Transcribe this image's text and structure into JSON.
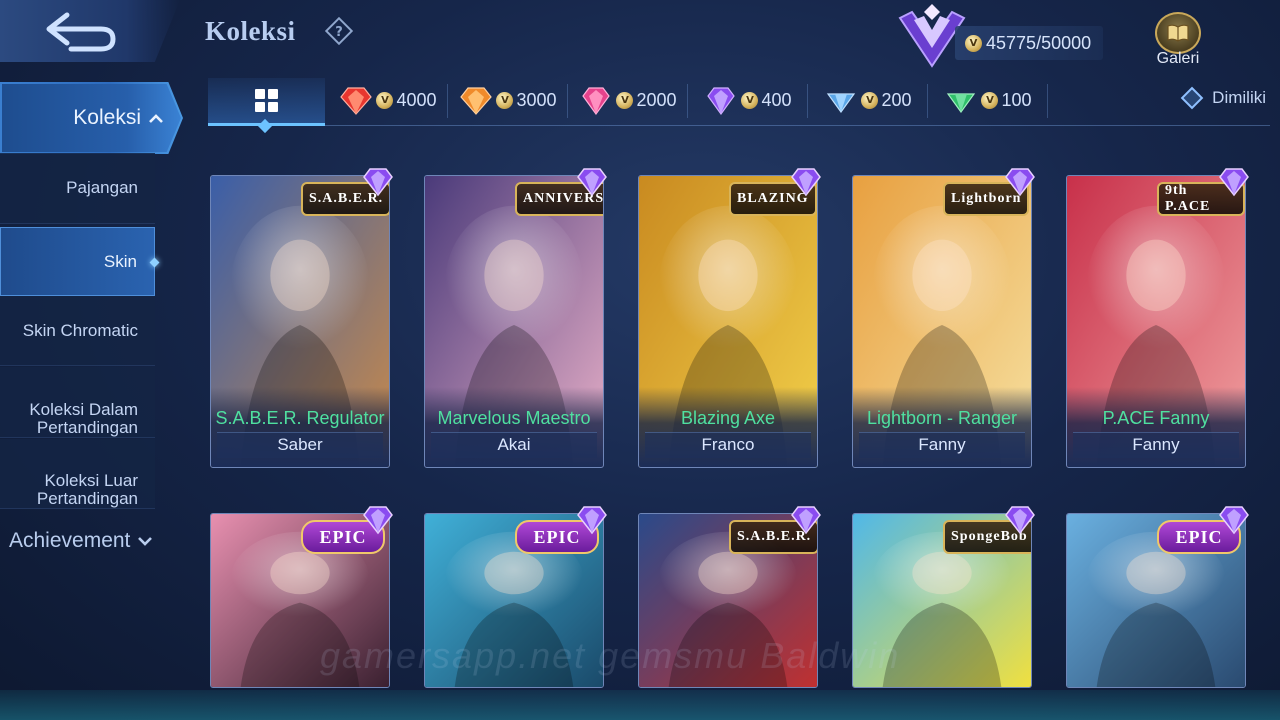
{
  "header": {
    "title": "Koleksi",
    "points_current": "45775",
    "points_max": "/50000",
    "galeri_label": "Galeri",
    "coin_symbol": "V"
  },
  "sidebar": {
    "main_label": "Koleksi",
    "items": [
      {
        "label": "Pajangan",
        "active": false
      },
      {
        "label": "Skin",
        "active": true
      },
      {
        "label": "Skin Chromatic",
        "active": false
      },
      {
        "label_line1": "Koleksi Dalam",
        "label_line2": "Pertandingan",
        "active": false
      },
      {
        "label_line1": "Koleksi Luar",
        "label_line2": "Pertandingan",
        "active": false
      }
    ],
    "achievement_label": "Achievement"
  },
  "tabs": [
    {
      "icon": "grid-icon",
      "active": true
    },
    {
      "icon": "red-gem-icon",
      "price": "4000",
      "color": "#e8362f"
    },
    {
      "icon": "orange-gem-icon",
      "price": "3000",
      "color": "#f08a2a"
    },
    {
      "icon": "pink-gem-icon",
      "price": "2000",
      "color": "#e6428c"
    },
    {
      "icon": "purple-gem-icon",
      "price": "400",
      "color": "#8a4cf0"
    },
    {
      "icon": "blue-gem-icon",
      "price": "200",
      "color": "#5aa6e8"
    },
    {
      "icon": "green-gem-icon",
      "price": "100",
      "color": "#2fbf6a"
    }
  ],
  "filter": {
    "label": "Dimiliki"
  },
  "cards_row1": [
    {
      "skin": "S.A.B.E.R. Regulator",
      "hero": "Saber",
      "badge": "S.A.B.E.R.",
      "bg1": "#3a5ea8",
      "bg2": "#c98a4a"
    },
    {
      "skin": "Marvelous Maestro",
      "hero": "Akai",
      "badge": "ANNIVERSARY",
      "bg1": "#4a3a7a",
      "bg2": "#e8b0c8"
    },
    {
      "skin": "Blazing Axe",
      "hero": "Franco",
      "badge": "BLAZING",
      "bg1": "#c98a20",
      "bg2": "#f2d04a"
    },
    {
      "skin": "Lightborn - Ranger",
      "hero": "Fanny",
      "badge": "Lightborn",
      "bg1": "#e8a040",
      "bg2": "#f6e0a0"
    },
    {
      "skin": "P.ACE Fanny",
      "hero": "Fanny",
      "badge": "9th P.ACE",
      "bg1": "#c8304a",
      "bg2": "#f0a0a0"
    }
  ],
  "cards_row2": [
    {
      "badge": "EPIC",
      "bg1": "#e890b0",
      "bg2": "#3a2030"
    },
    {
      "badge": "EPIC",
      "bg1": "#40b0d8",
      "bg2": "#1a4a6a"
    },
    {
      "badge": "S.A.B.E.R.",
      "bg1": "#2a4a8a",
      "bg2": "#c03030"
    },
    {
      "badge": "SpongeBob",
      "bg1": "#50b8e8",
      "bg2": "#f0e040"
    },
    {
      "badge": "EPIC",
      "bg1": "#6ab0e0",
      "bg2": "#2a4a70"
    }
  ],
  "watermark": "gamersapp.net gemsmu Baldwin"
}
